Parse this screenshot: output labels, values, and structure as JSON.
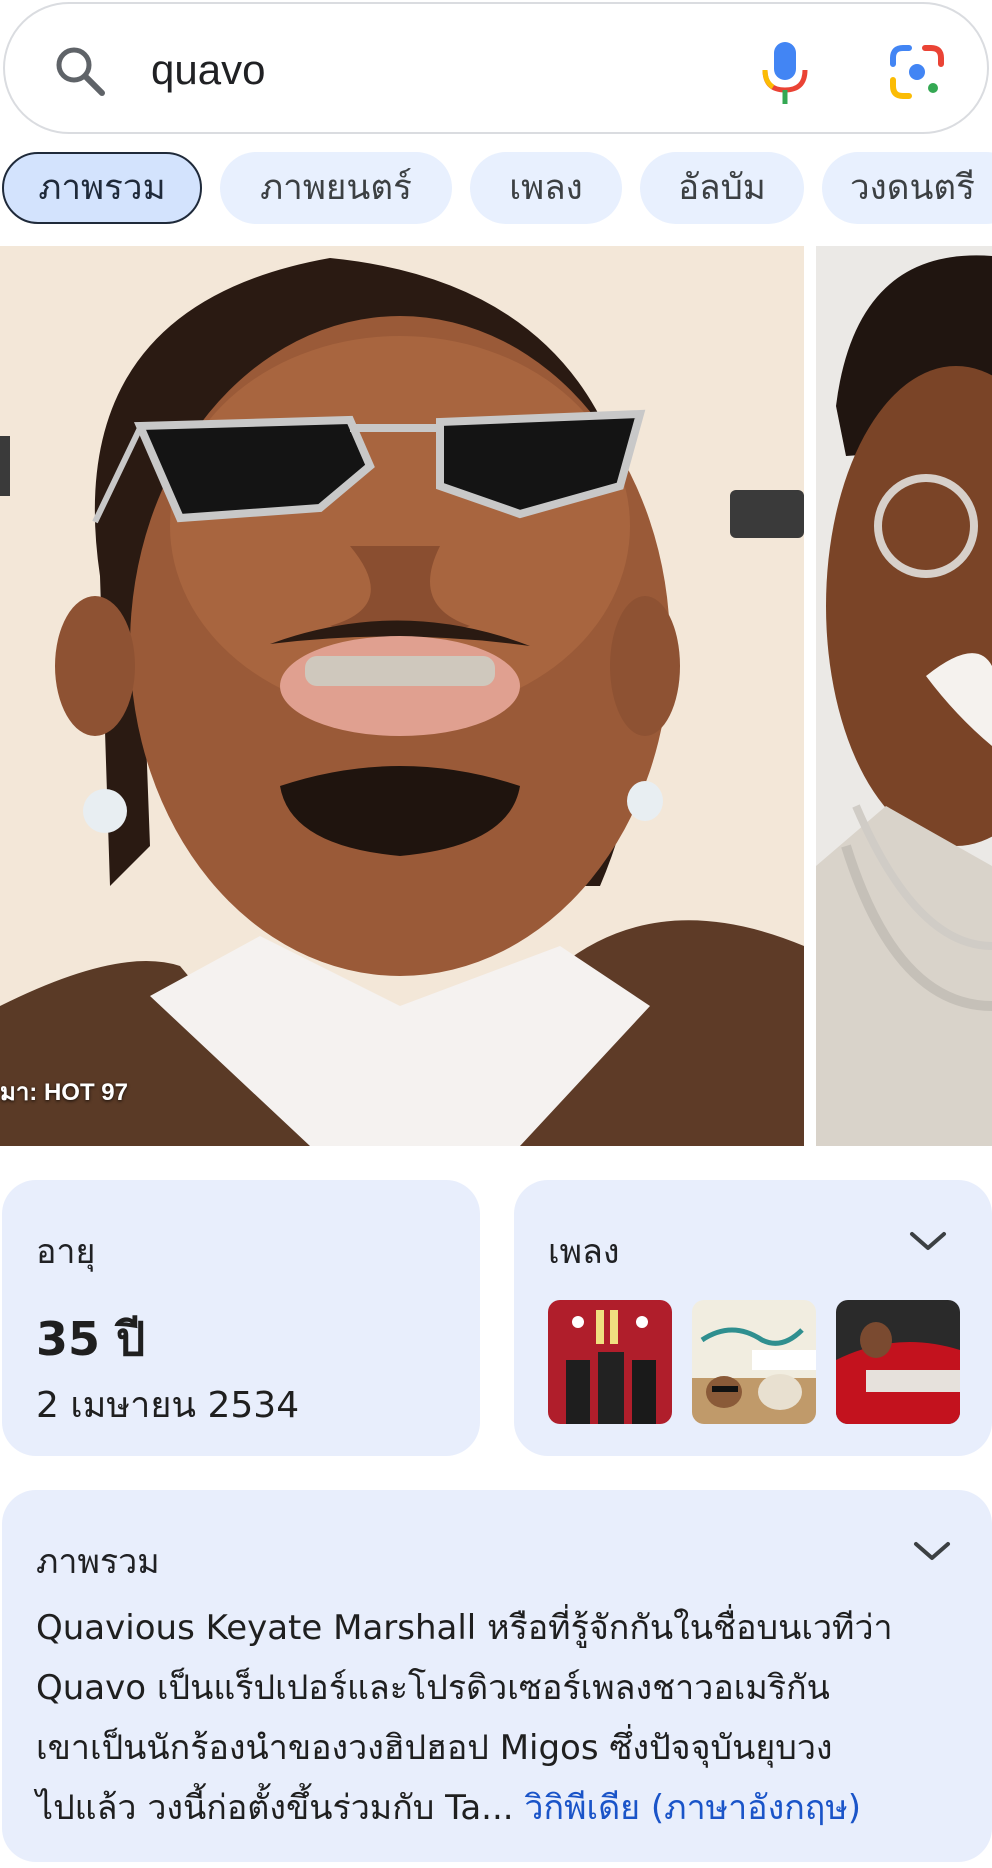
{
  "search": {
    "query": "quavo",
    "icons": [
      "search-icon",
      "mic-icon",
      "lens-icon"
    ]
  },
  "chips": [
    {
      "label": "ภาพรวม",
      "active": true
    },
    {
      "label": "ภาพยนตร์",
      "active": false
    },
    {
      "label": "เพลง",
      "active": false
    },
    {
      "label": "อัลบัม",
      "active": false
    },
    {
      "label": "วงดนตรี",
      "active": false
    }
  ],
  "photos": {
    "credit": "มา: HOT 97"
  },
  "age_card": {
    "label": "อายุ",
    "value": "35 ปี",
    "birth_date": "2 เมษายน 2534"
  },
  "songs_card": {
    "label": "เพลง"
  },
  "overview": {
    "label": "ภาพรวม",
    "lines": [
      "Quavious Keyate Marshall หรือที่รู้จักกันในชื่อบนเวทีว่า",
      "Quavo เป็นแร็ปเปอร์และโปรดิวเซอร์เพลงชาวอเมริกัน",
      "เขาเป็นนักร้องนำของวงฮิปฮอป Migos ซึ่งปัจจุบันยุบวง",
      "ไปแล้ว วงนี้ก่อตั้งขึ้นร่วมกับ Ta..."
    ],
    "source_link": "วิกิพีเดีย (ภาษาอังกฤษ)"
  },
  "colors": {
    "card_bg": "#e8eefc",
    "chip_bg": "#e8f0fe",
    "chip_active_bg": "#d3e3fd",
    "link": "#1a54c8"
  }
}
